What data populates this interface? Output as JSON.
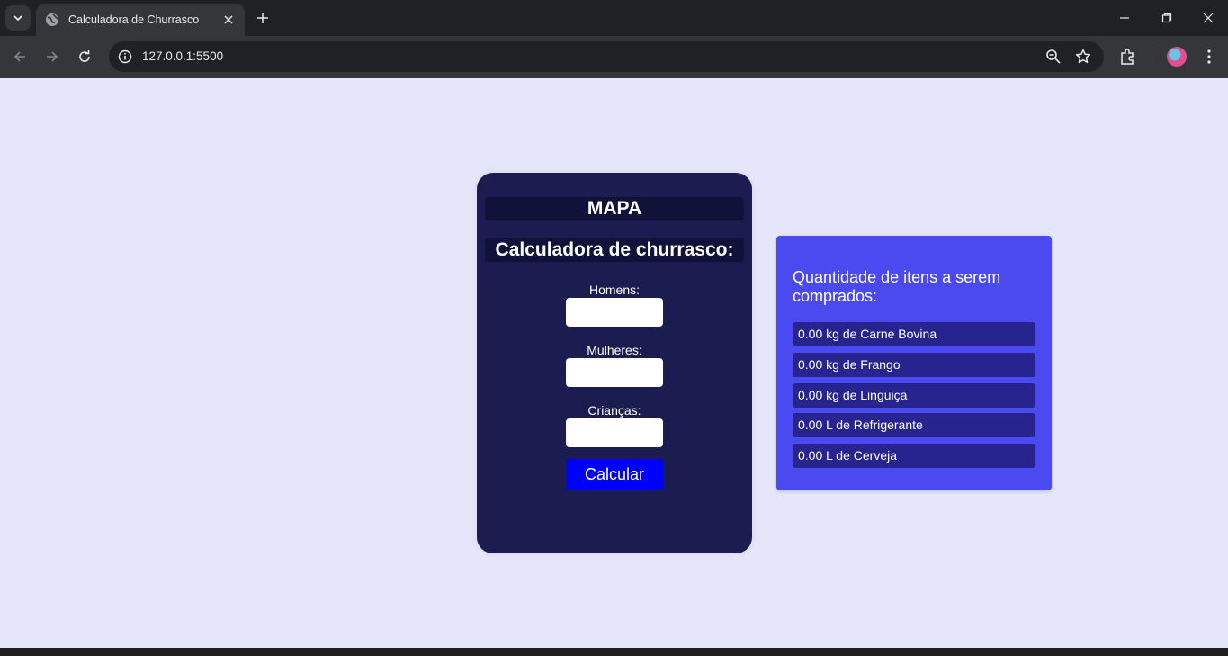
{
  "browser": {
    "tab_title": "Calculadora de Churrasco",
    "url": "127.0.0.1:5500"
  },
  "calculator": {
    "heading": "MAPA",
    "subtitle": "Calculadora de churrasco:",
    "fields": [
      {
        "label": "Homens:",
        "value": "",
        "placeholder": ""
      },
      {
        "label": "Mulheres:",
        "value": "",
        "placeholder": ""
      },
      {
        "label": "Crianças:",
        "value": "",
        "placeholder": ""
      }
    ],
    "button_label": "Calcular"
  },
  "results": {
    "title": "Quantidade de itens a serem comprados:",
    "items": [
      "0.00 kg de Carne Bovina",
      "0.00 kg de Frango",
      "0.00 kg de Linguiça",
      "0.00 L de Refrigerante",
      "0.00 L de Cerveja"
    ]
  },
  "colors": {
    "page_background": "#e6e6fa",
    "calculator_card": "#1b1c50",
    "calculate_button": "#0000ff",
    "results_card": "#4a4af0",
    "result_item": "#27238f"
  },
  "icons": [
    "tab-search-icon",
    "globe-icon",
    "close-icon",
    "plus-icon",
    "minimize-icon",
    "restore-icon",
    "back-icon",
    "forward-icon",
    "reload-icon",
    "info-icon",
    "zoom-icon",
    "star-icon",
    "extensions-icon",
    "profile-avatar",
    "menu-icon"
  ]
}
